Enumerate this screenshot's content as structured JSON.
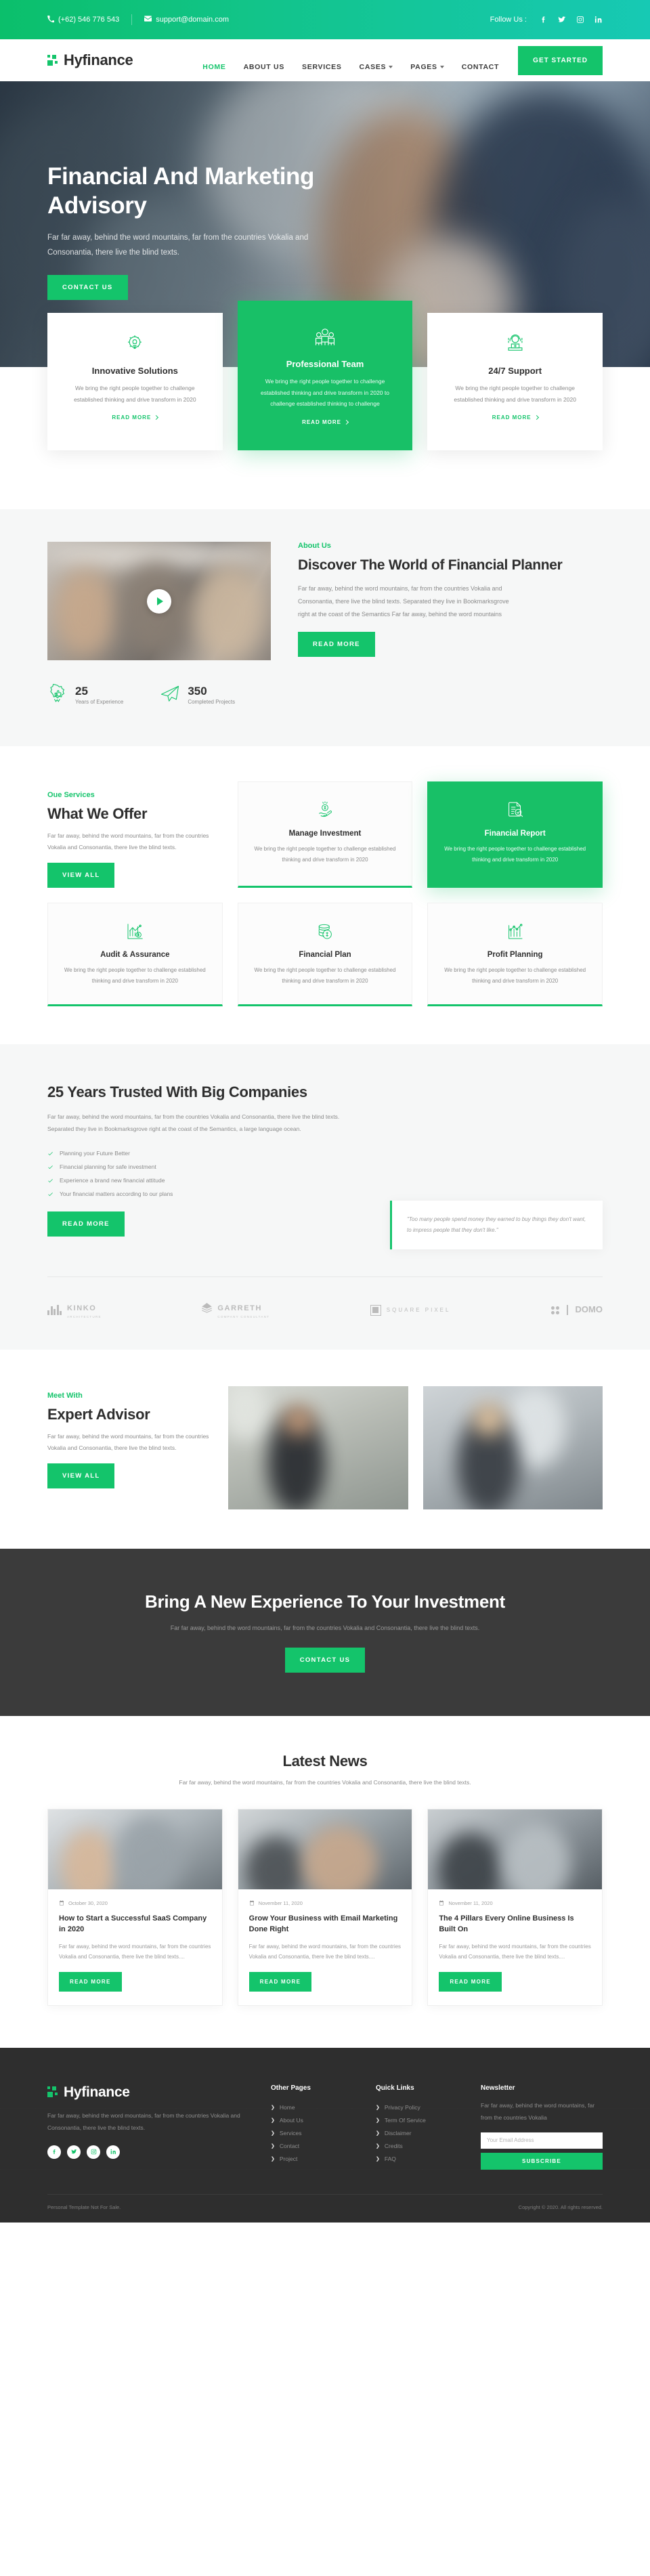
{
  "topbar": {
    "phone": "(+62) 546 776 543",
    "email": "support@domain.com",
    "follow_label": "Follow Us :",
    "socials": [
      "facebook-icon",
      "twitter-icon",
      "instagram-icon",
      "linkedin-icon"
    ]
  },
  "nav": {
    "brand": "Hyfinance",
    "items": [
      {
        "label": "HOME",
        "active": true,
        "caret": false
      },
      {
        "label": "ABOUT US",
        "active": false,
        "caret": false
      },
      {
        "label": "SERVICES",
        "active": false,
        "caret": false
      },
      {
        "label": "CASES",
        "active": false,
        "caret": true
      },
      {
        "label": "PAGES",
        "active": false,
        "caret": true
      },
      {
        "label": "CONTACT",
        "active": false,
        "caret": false
      }
    ],
    "cta": "GET STARTED"
  },
  "hero": {
    "title": "Financial And Marketing Advisory",
    "subtitle": "Far far away, behind the word mountains, far from the countries Vokalia and Consonantia, there live the blind texts.",
    "button": "CONTACT US"
  },
  "features": [
    {
      "icon": "lightbulb-gear-icon",
      "title": "Innovative Solutions",
      "text": "We bring the right people together to challenge established thinking and drive transform in 2020",
      "link": "READ MORE",
      "highlight": false
    },
    {
      "icon": "team-people-icon",
      "title": "Professional Team",
      "text": "We bring the right people together to challenge established thinking and drive transform in 2020 to challenge established thinking to challenge",
      "link": "READ MORE",
      "highlight": true
    },
    {
      "icon": "headset-support-icon",
      "title": "24/7 Support",
      "text": "We bring the right people together to challenge established thinking and drive transform in 2020",
      "link": "READ MORE",
      "highlight": false
    }
  ],
  "about": {
    "eyebrow": "About Us",
    "title": "Discover The World of Financial Planner",
    "text": "Far far away, behind the word mountains, far from the countries Vokalia and Consonantia, there live the blind texts. Separated they live in Bookmarksgrove right at the coast of the Semantics Far far away, behind the word mountains",
    "button": "READ MORE",
    "play_icon": "play-button-icon",
    "stats": [
      {
        "icon": "badge-thumbsup-icon",
        "number": "25",
        "label": "Years of Experience"
      },
      {
        "icon": "paper-plane-icon",
        "number": "350",
        "label": "Completed Projects"
      }
    ]
  },
  "services": {
    "eyebrow": "Oue Services",
    "title": "What We Offer",
    "text": "Far far away, behind the word mountains, far from the countries Vokalia and Consonantia, there live the blind texts.",
    "button": "VIEW ALL",
    "cards": [
      {
        "icon": "hand-coin-icon",
        "title": "Manage Investment",
        "text": "We bring the right people together to challenge established thinking and drive transform in 2020",
        "highlight": false
      },
      {
        "icon": "document-search-icon",
        "title": "Financial Report",
        "text": "We bring the right people together to challenge established thinking and drive transform in 2020",
        "highlight": true
      },
      {
        "icon": "bar-chart-dollar-icon",
        "title": "Audit & Assurance",
        "text": "We bring the right people together to challenge established thinking and drive transform in 2020",
        "highlight": false
      },
      {
        "icon": "coins-stack-icon",
        "title": "Financial Plan",
        "text": "We bring the right people together to challenge established thinking and drive transform in 2020",
        "highlight": false
      },
      {
        "icon": "growth-chart-icon",
        "title": "Profit Planning",
        "text": "We bring the right people together to challenge established thinking and drive transform in 2020",
        "highlight": false
      }
    ]
  },
  "trusted": {
    "title": "25 Years Trusted With Big Companies",
    "text": "Far far away, behind the word mountains, far from the countries Vokalia and Consonantia, there live the blind texts. Separated they live in Bookmarksgrove right at the coast of the Semantics, a large language ocean.",
    "checklist": [
      "Planning your Future Better",
      "Financial planning for safe investment",
      "Experience a brand new financial attitude",
      "Your financial matters according to our plans"
    ],
    "button": "READ MORE",
    "quote": "\"Too many people spend money they earned to buy things they don't want, to impress people that they don't like.\""
  },
  "clients": [
    {
      "name": "KINKO",
      "sub": "ARCHITECTURE",
      "icon": "bars-logo-icon"
    },
    {
      "name": "GARRETH",
      "sub": "COMPANY CONSULTANT",
      "icon": "chevron-stack-logo-icon"
    },
    {
      "name": "SQUARE PIXEL",
      "sub": "",
      "icon": "framed-square-logo-icon"
    },
    {
      "name": "DOMO",
      "sub": "",
      "icon": "dots-bar-logo-icon"
    }
  ],
  "team": {
    "eyebrow": "Meet With",
    "title": "Expert Advisor",
    "text": "Far far away, behind the word mountains, far from the countries Vokalia and Consonantia, there live the blind texts.",
    "button": "VIEW ALL"
  },
  "cta": {
    "title": "Bring A New Experience To Your Investment",
    "text": "Far far away, behind the word mountains, far from the countries Vokalia and Consonantia, there live the blind texts.",
    "button": "CONTACT US"
  },
  "news": {
    "title": "Latest News",
    "subtitle": "Far far away, behind the word mountains, far from the countries Vokalia and Consonantia, there live the blind texts.",
    "posts": [
      {
        "date": "October 30, 2020",
        "title": "How to Start a Successful SaaS Company in 2020",
        "excerpt": "Far far away, behind the word mountains, far from the countries Vokalia and Consonantia, there live the blind texts....",
        "button": "READ MORE"
      },
      {
        "date": "November 11, 2020",
        "title": "Grow Your Business with Email Marketing Done Right",
        "excerpt": "Far far away, behind the word mountains, far from the countries Vokalia and Consonantia, there live the blind texts....",
        "button": "READ MORE"
      },
      {
        "date": "November 11, 2020",
        "title": "The 4 Pillars Every Online Business Is Built On",
        "excerpt": "Far far away, behind the word mountains, far from the countries Vokalia and Consonantia, there live the blind texts....",
        "button": "READ MORE"
      }
    ]
  },
  "footer": {
    "brand": "Hyfinance",
    "description": "Far far away, behind the word mountains, far from the countries Vokalia and Consonantia, there live the blind texts.",
    "socials": [
      "facebook-icon",
      "twitter-icon",
      "instagram-icon",
      "linkedin-icon"
    ],
    "other_pages": {
      "title": "Other Pages",
      "items": [
        "Home",
        "About Us",
        "Services",
        "Contact",
        "Project"
      ]
    },
    "quick_links": {
      "title": "Quick Links",
      "items": [
        "Privacy Policy",
        "Term Of Service",
        "Disclaimer",
        "Credits",
        "FAQ"
      ]
    },
    "newsletter": {
      "title": "Newsletter",
      "text": "Far far away, behind the word mountains, far from the countries Vokalia",
      "placeholder": "Your Email Address",
      "button": "SUBSCRIBE"
    },
    "bottom_left": "Personal Template Not For Sale.",
    "bottom_right": "Copyright © 2020. All rights reserved."
  },
  "colors": {
    "accent": "#14c46b",
    "accent_card": "#18c067",
    "dark": "#2e2e2e",
    "cta_dark": "#3b3b3b",
    "muted_text": "#8a8a8a"
  }
}
